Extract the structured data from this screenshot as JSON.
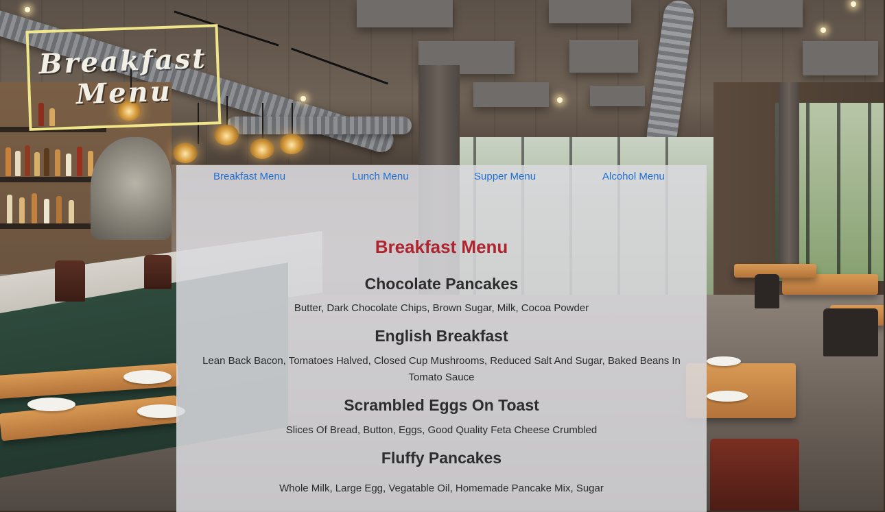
{
  "logo": {
    "line1": "Breakfast",
    "line2": "Menu"
  },
  "nav": {
    "items": [
      {
        "label": "Breakfast Menu"
      },
      {
        "label": "Lunch Menu"
      },
      {
        "label": "Supper Menu"
      },
      {
        "label": "Alcohol Menu"
      }
    ]
  },
  "menu": {
    "title": "Breakfast Menu",
    "items": [
      {
        "name": "Chocolate Pancakes",
        "ingredients": "Butter, Dark Chocolate Chips, Brown Sugar, Milk, Cocoa Powder"
      },
      {
        "name": "English Breakfast",
        "ingredients": "Lean Back Bacon, Tomatoes Halved, Closed Cup Mushrooms, Reduced Salt And Sugar, Baked Beans In Tomato Sauce"
      },
      {
        "name": "Scrambled Eggs On Toast",
        "ingredients": "Slices Of Bread, Button, Eggs, Good Quality Feta Cheese Crumbled"
      },
      {
        "name": "Fluffy Pancakes",
        "ingredients": "Whole Milk, Large Egg, Vegatable Oil, Homemade Pancake Mix, Sugar"
      }
    ]
  },
  "colors": {
    "nav_link": "#1f6fd1",
    "title": "#b0242f",
    "logo_border": "#efe58a"
  }
}
